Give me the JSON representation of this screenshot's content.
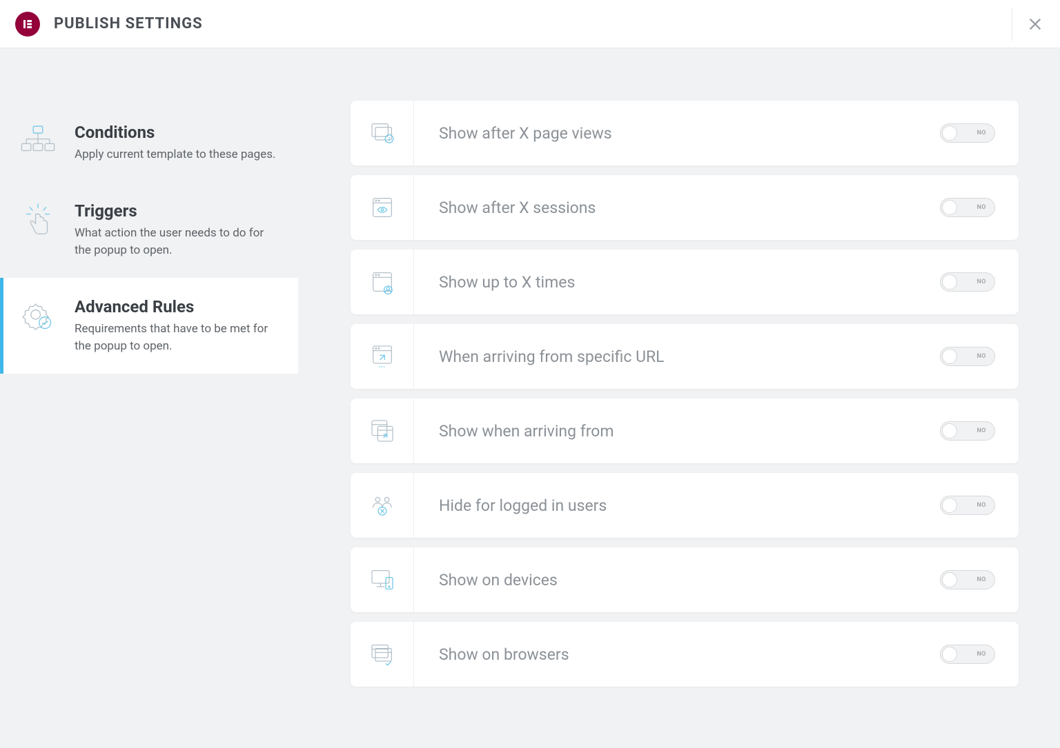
{
  "header": {
    "title": "PUBLISH SETTINGS"
  },
  "sidebar": {
    "items": [
      {
        "title": "Conditions",
        "desc": "Apply current template to these pages."
      },
      {
        "title": "Triggers",
        "desc": "What action the user needs to do for the popup to open."
      },
      {
        "title": "Advanced Rules",
        "desc": "Requirements that have to be met for the popup to open."
      }
    ]
  },
  "rules": [
    {
      "label": "Show after X page views",
      "toggle": "NO"
    },
    {
      "label": "Show after X sessions",
      "toggle": "NO"
    },
    {
      "label": "Show up to X times",
      "toggle": "NO"
    },
    {
      "label": "When arriving from specific URL",
      "toggle": "NO"
    },
    {
      "label": "Show when arriving from",
      "toggle": "NO"
    },
    {
      "label": "Hide for logged in users",
      "toggle": "NO"
    },
    {
      "label": "Show on devices",
      "toggle": "NO"
    },
    {
      "label": "Show on browsers",
      "toggle": "NO"
    }
  ]
}
